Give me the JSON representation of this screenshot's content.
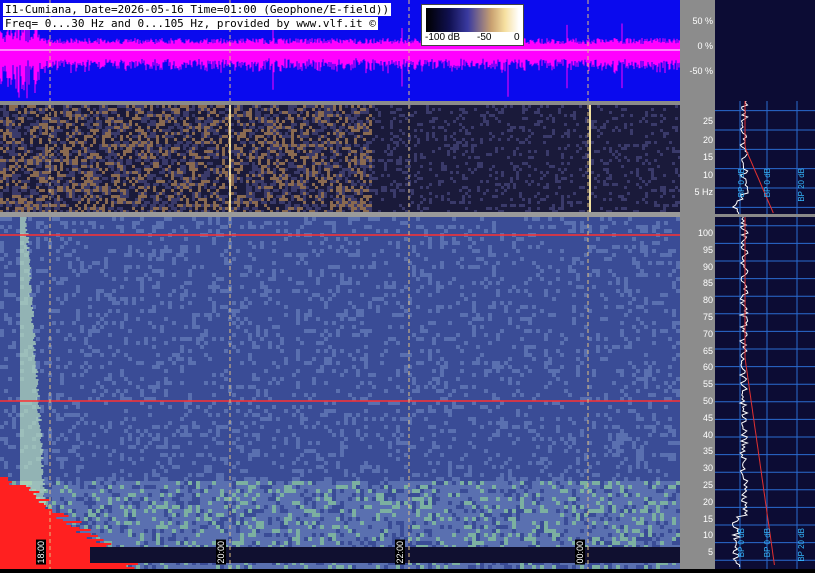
{
  "header": {
    "line1": "I1-Cumiana, Date=2026-05-16 Time=01:00 (Geophone/E-field))",
    "line2": "Freq= 0...30 Hz and 0...105 Hz, provided by www.vlf.it ©"
  },
  "legend": {
    "min_label": "-100 dB",
    "mid_label": "-50",
    "max_label": "0"
  },
  "waveform_axis": [
    "50 %",
    "0 %",
    "-50 %"
  ],
  "spectrogram1_axis": [
    "25",
    "20",
    "15",
    "10",
    "5 Hz"
  ],
  "spectrogram2_axis": [
    "100",
    "95",
    "90",
    "85",
    "80",
    "75",
    "70",
    "65",
    "60",
    "55",
    "50",
    "45",
    "40",
    "35",
    "30",
    "25",
    "20",
    "15",
    "10",
    "5"
  ],
  "time_labels": [
    "18:00",
    "20:00",
    "22:00",
    "00:00"
  ],
  "side_top_labels": [
    "BP 0 dB",
    "BP 0 dB",
    "BP 20 dB"
  ],
  "side_bottom_labels": [
    "BP 0 dB",
    "BP 0 dB",
    "BP 20 dB"
  ],
  "colors": {
    "waveform_bg": "#0a0aee",
    "waveform_signal": "#ff00ff",
    "spectrum_bg": "#3a4f9a",
    "highlight_line": "#ff3030",
    "side_bg": "#0c0c34",
    "side_grid": "#2a6bd0"
  }
}
